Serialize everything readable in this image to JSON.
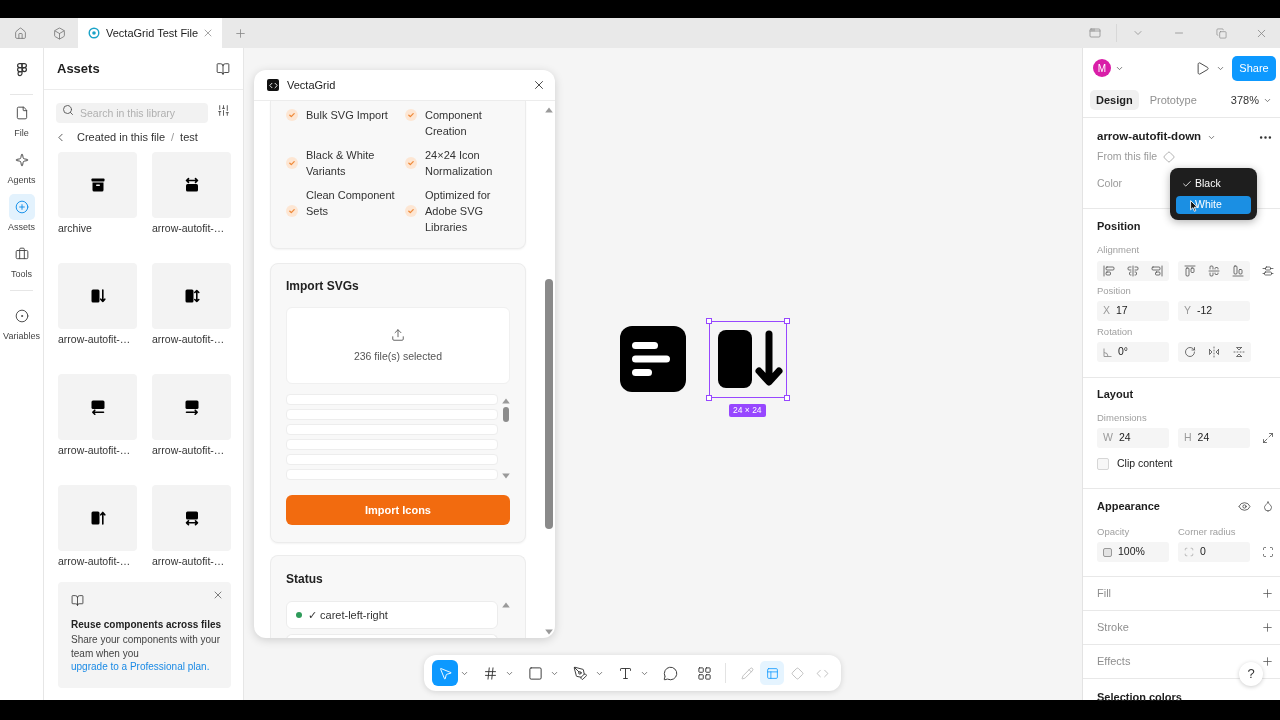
{
  "tab_bar": {
    "tabs": [
      {
        "title": "VectaGrid Test File",
        "selected": true
      }
    ]
  },
  "left_rail": {
    "items": [
      {
        "label": "File",
        "kind": "file",
        "selected": false
      },
      {
        "label": "Agents",
        "kind": "agents",
        "selected": false
      },
      {
        "label": "Assets",
        "kind": "assets",
        "selected": true
      },
      {
        "label": "Tools",
        "kind": "tools",
        "selected": false
      },
      {
        "label": "Variables",
        "kind": "variables",
        "selected": false
      }
    ]
  },
  "assets_panel": {
    "title": "Assets",
    "search": {
      "placeholder": "Search in this library"
    },
    "breadcrumb": {
      "items": [
        "Created in this file",
        "test"
      ],
      "separator": "/"
    },
    "tiles": [
      {
        "label": "archive",
        "kind": "archive"
      },
      {
        "label": "arrow-autofit-…",
        "kind": "width_top"
      },
      {
        "label": "arrow-autofit-…",
        "kind": "down"
      },
      {
        "label": "arrow-autofit-…",
        "kind": "height"
      },
      {
        "label": "arrow-autofit-…",
        "kind": "left"
      },
      {
        "label": "arrow-autofit-…",
        "kind": "right"
      },
      {
        "label": "arrow-autofit-…",
        "kind": "up"
      },
      {
        "label": "arrow-autofit-…",
        "kind": "width_bottom"
      }
    ],
    "promo": {
      "title": "Reuse components across files",
      "text": "Share your components with your team when you",
      "link": "upgrade to a Professional plan."
    }
  },
  "plugin_window": {
    "title": "VectaGrid",
    "features": [
      "Bulk SVG Import",
      "Component Creation",
      "Black & White Variants",
      "24×24 Icon Normalization",
      "Clean Component Sets",
      "Optimized for Adobe SVG Libraries"
    ],
    "import": {
      "title": "Import SVGs",
      "selected_count": "236 file(s) selected",
      "button": "Import Icons"
    },
    "status": {
      "title": "Status",
      "rows": [
        {
          "text": "✓ caret-left-right",
          "color": "#2e9b5a"
        }
      ]
    }
  },
  "canvas": {
    "selection_label": "24 × 24"
  },
  "canvas_toolbar": {
    "tools": [
      {
        "kind": "move",
        "selected": true
      },
      {
        "kind": "frame",
        "selected": false
      },
      {
        "kind": "rectangle",
        "selected": false
      },
      {
        "kind": "pen",
        "selected": false
      },
      {
        "kind": "text",
        "selected": false
      },
      {
        "kind": "comment",
        "selected": false
      },
      {
        "kind": "actions",
        "selected": false
      }
    ],
    "modes": [
      {
        "kind": "draw",
        "selected": false
      },
      {
        "kind": "design",
        "selected": true
      },
      {
        "kind": "slides",
        "selected": false
      },
      {
        "kind": "dev",
        "selected": false
      }
    ]
  },
  "right_panel": {
    "avatar": "M",
    "share": "Share",
    "tabs": [
      {
        "label": "Design",
        "selected": true
      },
      {
        "label": "Prototype",
        "selected": false
      }
    ],
    "zoom": "378%",
    "component": {
      "name": "arrow-autofit-down",
      "source": "From this file",
      "property": {
        "label": "Color",
        "menu": [
          {
            "label": "Black",
            "checked": true,
            "highlighted": false
          },
          {
            "label": "White",
            "checked": false,
            "highlighted": true
          }
        ]
      }
    },
    "position": {
      "title": "Position",
      "alignment_label": "Alignment",
      "position_label": "Position",
      "x": {
        "prefix": "X",
        "value": "17"
      },
      "y": {
        "prefix": "Y",
        "value": "-12"
      },
      "rotation_label": "Rotation",
      "rotation": "0°"
    },
    "layout": {
      "title": "Layout",
      "dimensions_label": "Dimensions",
      "width": {
        "prefix": "W",
        "value": "24"
      },
      "height": {
        "prefix": "H",
        "value": "24"
      },
      "clip_content": {
        "label": "Clip content",
        "checked": false
      }
    },
    "appearance": {
      "title": "Appearance",
      "opacity_label": "Opacity",
      "opacity": "100%",
      "corner_radius_label": "Corner radius",
      "corner_radius": "0"
    },
    "sections": [
      {
        "title": "Fill"
      },
      {
        "title": "Stroke"
      },
      {
        "title": "Effects"
      }
    ],
    "selection_colors": "Selection colors",
    "help": "?"
  }
}
